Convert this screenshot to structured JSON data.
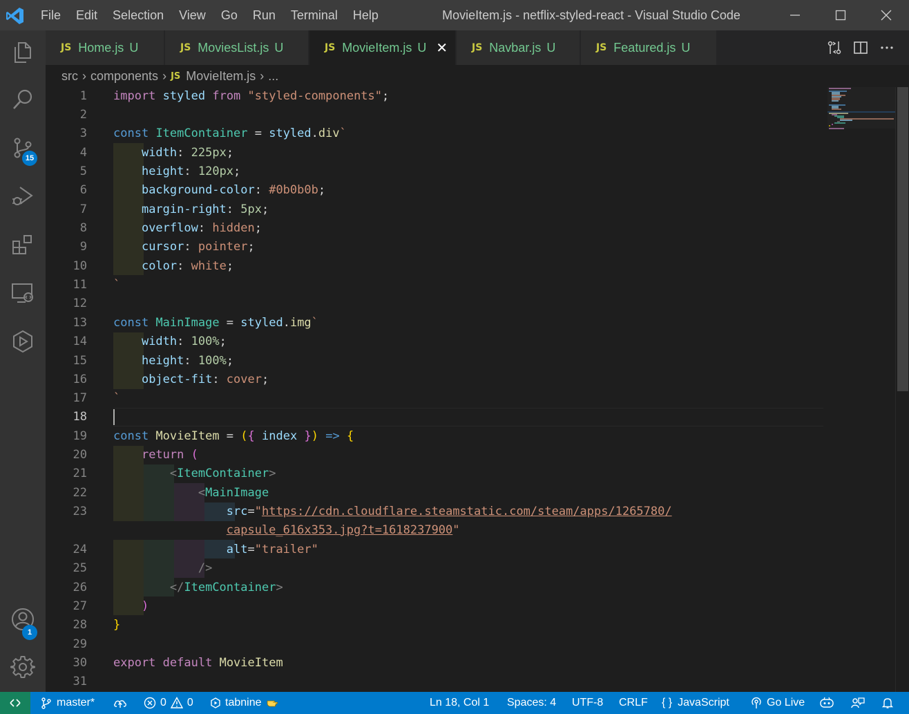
{
  "window": {
    "title": "MovieItem.js - netflix-styled-react - Visual Studio Code",
    "menu": [
      "File",
      "Edit",
      "Selection",
      "View",
      "Go",
      "Run",
      "Terminal",
      "Help"
    ]
  },
  "activity_bar": {
    "items": [
      {
        "icon": "files-icon"
      },
      {
        "icon": "search-icon"
      },
      {
        "icon": "source-control-icon",
        "badge": "15"
      },
      {
        "icon": "run-debug-icon"
      },
      {
        "icon": "extensions-icon"
      },
      {
        "icon": "remote-explorer-icon"
      },
      {
        "icon": "tabnine-hub-icon"
      }
    ],
    "bottom": [
      {
        "icon": "accounts-icon",
        "badge": "1"
      },
      {
        "icon": "settings-gear-icon"
      }
    ]
  },
  "tabs": [
    {
      "badge": "JS",
      "label": "Home.js",
      "status": "U",
      "active": false
    },
    {
      "badge": "JS",
      "label": "MoviesList.js",
      "status": "U",
      "active": false
    },
    {
      "badge": "JS",
      "label": "MovieItem.js",
      "status": "U",
      "active": true
    },
    {
      "badge": "JS",
      "label": "Navbar.js",
      "status": "U",
      "active": false
    },
    {
      "badge": "JS",
      "label": "Featured.js",
      "status": "U",
      "active": false
    }
  ],
  "breadcrumb": {
    "parts": [
      "src",
      "components"
    ],
    "file_badge": "JS",
    "file": "MovieItem.js",
    "more": "..."
  },
  "editor": {
    "current_line": "18",
    "line_numbers": [
      "1",
      "2",
      "3",
      "4",
      "5",
      "6",
      "7",
      "8",
      "9",
      "10",
      "11",
      "12",
      "13",
      "14",
      "15",
      "16",
      "17",
      "18",
      "19",
      "20",
      "21",
      "22",
      "23",
      "24",
      "25",
      "26",
      "27",
      "28",
      "29",
      "30",
      "31"
    ],
    "lines": [
      "import styled from \"styled-components\";",
      "",
      "const ItemContainer = styled.div`",
      "    width: 225px;",
      "    height: 120px;",
      "    background-color: #0b0b0b;",
      "    margin-right: 5px;",
      "    overflow: hidden;",
      "    cursor: pointer;",
      "    color: white;",
      "`",
      "",
      "const MainImage = styled.img`",
      "    width: 100%;",
      "    height: 100%;",
      "    object-fit: cover;",
      "`",
      "",
      "const MovieItem = ({ index }) => {",
      "    return (",
      "        <ItemContainer>",
      "            <MainImage",
      "                src=\"https://cdn.cloudflare.steamstatic.com/steam/apps/1265780/",
      "                capsule_616x353.jpg?t=1618237900\"",
      "                alt=\"trailer\"",
      "            />",
      "        </ItemContainer>",
      "    )",
      "}",
      "",
      "export default MovieItem",
      ""
    ]
  },
  "status_bar": {
    "branch": "master*",
    "errors": "0",
    "warnings": "0",
    "tabnine": "tabnine",
    "position": "Ln 18, Col 1",
    "spaces": "Spaces: 4",
    "encoding": "UTF-8",
    "eol": "CRLF",
    "language_braces": "{ }",
    "language": "JavaScript",
    "go_live": "Go Live"
  },
  "colors": {
    "activity_bar": "#333333",
    "title_bar": "#3c3c3c",
    "editor_bg": "#1e1e1e",
    "status_bar": "#007acc",
    "remote_indicator": "#16825d",
    "untracked_file": "#73c991",
    "js_badge": "#cbcb41"
  }
}
